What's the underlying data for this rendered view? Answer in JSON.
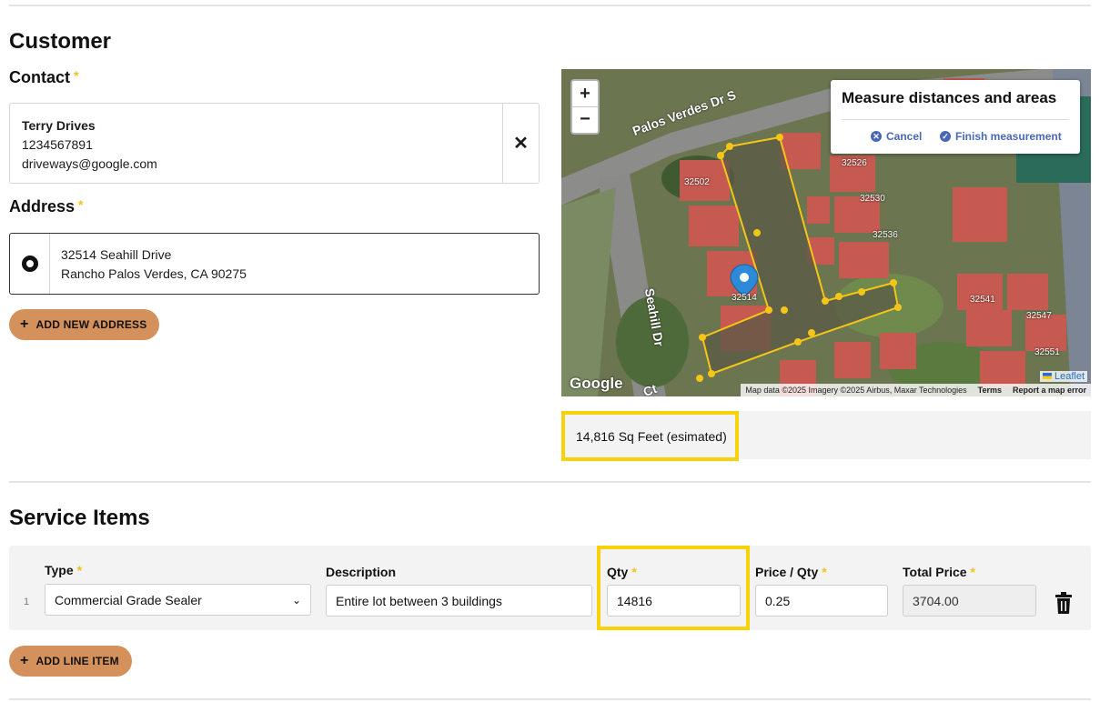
{
  "customer": {
    "section_title": "Customer",
    "contact_label": "Contact",
    "required_mark": "*",
    "contact": {
      "name": "Terry Drives",
      "phone": "1234567891",
      "email": "driveways@google.com",
      "remove_symbol": "✕"
    },
    "address_label": "Address",
    "address": {
      "line1": "32514 Seahill Drive",
      "line2": "Rancho Palos Verdes, CA 90275"
    },
    "add_address_label": "ADD NEW ADDRESS"
  },
  "map": {
    "zoom_in": "+",
    "zoom_out": "−",
    "measure_title": "Measure distances and areas",
    "cancel_label": "Cancel",
    "finish_label": "Finish measurement",
    "street_labels": [
      "Palos Verdes Dr S",
      "Seahill Dr",
      "Ct"
    ],
    "parcel_labels": [
      "32502",
      "32526",
      "32530",
      "32536",
      "32514",
      "32541",
      "32547",
      "32551"
    ],
    "google_label": "Google",
    "leaflet_label": "Leaflet",
    "attribution": "Map data ©2025 Imagery ©2025 Airbus, Maxar Technologies",
    "terms": "Terms",
    "report": "Report a map error",
    "estimate": "14,816 Sq Feet (esimated)"
  },
  "service": {
    "section_title": "Service Items",
    "columns": {
      "type": "Type",
      "description": "Description",
      "qty": "Qty",
      "price": "Price / Qty",
      "total": "Total Price"
    },
    "rows": [
      {
        "num": "1",
        "type": "Commercial Grade Sealer",
        "description": "Entire lot between 3 buildings",
        "qty": "14816",
        "price": "0.25",
        "total": "3704.00"
      }
    ],
    "add_line_label": "ADD LINE ITEM"
  },
  "colors": {
    "accent": "#d4915c",
    "highlight": "#f7d20a",
    "required": "#f2c21c",
    "link": "#4a67b7"
  }
}
